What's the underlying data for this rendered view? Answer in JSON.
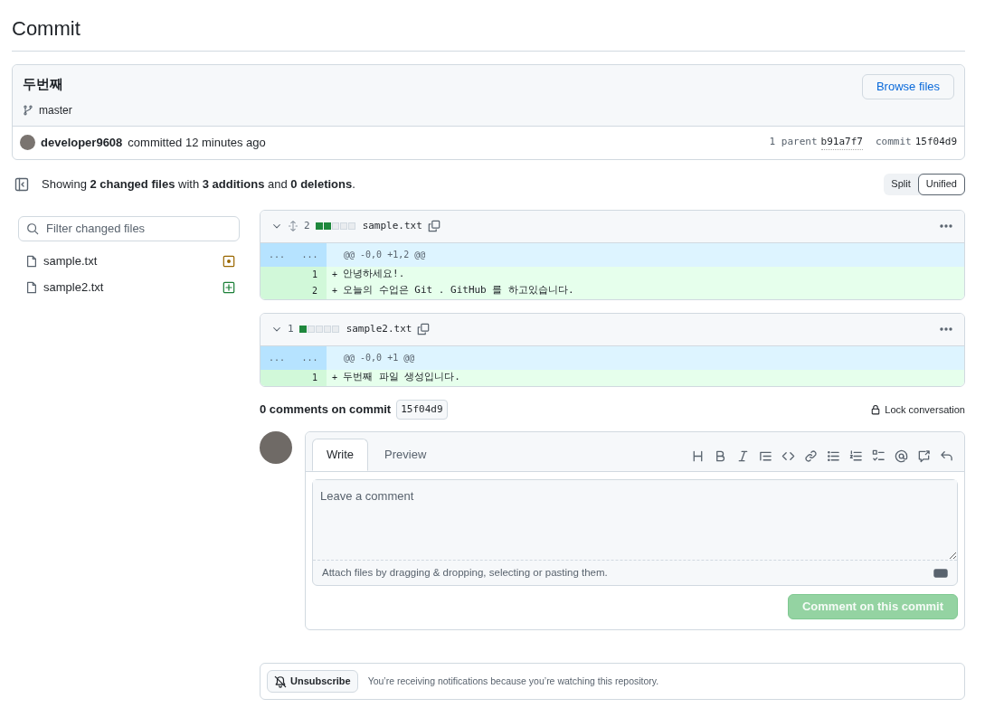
{
  "page_title": "Commit",
  "commit": {
    "message": "두번째",
    "branch": "master",
    "browse_button": "Browse files",
    "author": "developer9608",
    "action": "committed 12 minutes ago",
    "parent_label": "1 parent",
    "parent_sha": "b91a7f7",
    "commit_label": "commit",
    "commit_sha": "15f04d9"
  },
  "summary": "Showing **2 changed files** with **3 additions** and **0 deletions**.",
  "view_toggle": [
    {
      "label": "Split",
      "selected": false
    },
    {
      "label": "Unified",
      "selected": true
    }
  ],
  "file_filter": {
    "placeholder": "Filter changed files"
  },
  "file_tree": [
    {
      "name": "sample.txt",
      "kind": "modified"
    },
    {
      "name": "sample2.txt",
      "kind": "added"
    }
  ],
  "diffs": [
    {
      "count": "2",
      "blocks": [
        {
          "kind": "added"
        },
        {
          "kind": "added"
        },
        {
          "kind": "neutral"
        },
        {
          "kind": "neutral"
        },
        {
          "kind": "neutral"
        }
      ],
      "filename": "sample.txt",
      "hunk": {
        "old": "...",
        "new": "...",
        "header": "@@ -0,0 +1,2 @@"
      },
      "lines": [
        {
          "number": "1",
          "marker": "+",
          "text": "안녕하세요!."
        },
        {
          "number": "2",
          "marker": "+",
          "text": "오늘의 수업은 Git . GitHub 를 하고있습니다."
        }
      ]
    },
    {
      "count": "1",
      "blocks": [
        {
          "kind": "added"
        },
        {
          "kind": "neutral"
        },
        {
          "kind": "neutral"
        },
        {
          "kind": "neutral"
        },
        {
          "kind": "neutral"
        }
      ],
      "filename": "sample2.txt",
      "hunk": {
        "old": "...",
        "new": "...",
        "header": "@@ -0,0 +1 @@"
      },
      "lines": [
        {
          "number": "1",
          "marker": "+",
          "text": "두번째 파일 생성입니다."
        }
      ]
    }
  ],
  "comments": {
    "title": "0 comments on commit",
    "sha": "15f04d9",
    "lock": "Lock conversation"
  },
  "editor": {
    "tabs": [
      {
        "label": "Write",
        "selected": true
      },
      {
        "label": "Preview",
        "selected": false
      }
    ],
    "placeholder": "Leave a comment",
    "attach_hint": "Attach files by dragging & dropping, selecting or pasting them.",
    "submit": "Comment on this commit",
    "submit_disabled": true
  },
  "notifications": {
    "button": "Unsubscribe",
    "text": "You’re receiving notifications because you’re watching this repository."
  }
}
